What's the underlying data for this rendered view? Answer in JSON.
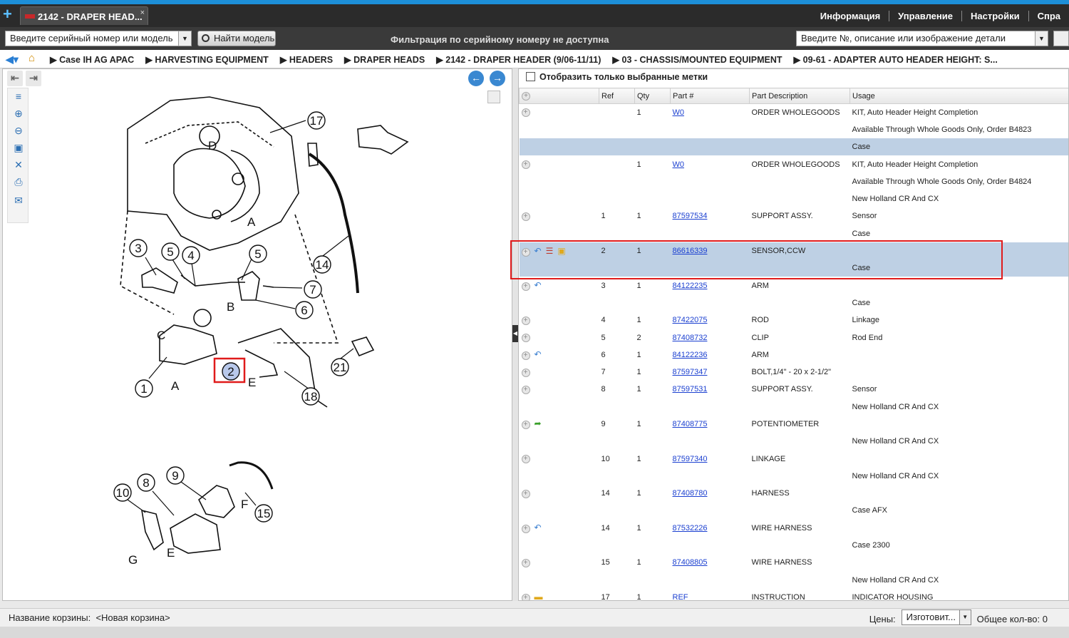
{
  "window": {
    "tab_title": "2142 - DRAPER HEAD...",
    "tab_close": "×",
    "new_tab": "+"
  },
  "topmenu": [
    "Информация",
    "Управление",
    "Настройки",
    "Спра"
  ],
  "toolbar": {
    "serial_input": "Введите серийный номер или модель",
    "find_model_button": "Найти модель",
    "filter_message": "Фильтрация по серийному номеру не доступна",
    "part_search_input": "Введите №, описание или изображение детали"
  },
  "breadcrumb": [
    "Case IH AG APAC",
    "HARVESTING EQUIPMENT",
    "HEADERS",
    "DRAPER HEADS",
    "2142 - DRAPER HEADER (9/06-11/11)",
    "03 - CHASSIS/MOUNTED EQUIPMENT",
    "09-61 - ADAPTER AUTO HEADER HEIGHT: S..."
  ],
  "diagram": {
    "callouts": [
      "17",
      "14",
      "3",
      "5",
      "4",
      "5",
      "7",
      "6",
      "1",
      "2",
      "18",
      "21",
      "10",
      "8",
      "9",
      "15"
    ],
    "letters": [
      "D",
      "A",
      "B",
      "C",
      "E",
      "A",
      "F",
      "G",
      "E"
    ]
  },
  "parts_panel": {
    "show_selected_label": "Отобразить только выбранные метки",
    "columns": [
      "Ref",
      "Qty",
      "Part #",
      "Part Description",
      "Usage"
    ],
    "rows": [
      {
        "ref": "",
        "qty": "1",
        "part": "W0",
        "desc": "ORDER WHOLEGOODS",
        "usage": "KIT, Auto Header Height Completion",
        "icons": []
      },
      {
        "ref": "",
        "qty": "",
        "part": "",
        "desc": "",
        "usage": "Available Through Whole Goods Only, Order B4823",
        "icons": []
      },
      {
        "ref": "",
        "qty": "",
        "part": "",
        "desc": "",
        "usage": "Case",
        "icons": [],
        "highlight": true
      },
      {
        "ref": "",
        "qty": "1",
        "part": "W0",
        "desc": "ORDER WHOLEGOODS",
        "usage": "KIT, Auto Header Height Completion",
        "icons": []
      },
      {
        "ref": "",
        "qty": "",
        "part": "",
        "desc": "",
        "usage": "Available Through Whole Goods Only, Order B4824",
        "icons": []
      },
      {
        "ref": "",
        "qty": "",
        "part": "",
        "desc": "",
        "usage": "New Holland CR And CX",
        "icons": []
      },
      {
        "ref": "1",
        "qty": "1",
        "part": "87597534",
        "desc": "SUPPORT ASSY.",
        "usage": "Sensor",
        "icons": []
      },
      {
        "ref": "",
        "qty": "",
        "part": "",
        "desc": "",
        "usage": "Case",
        "icons": []
      },
      {
        "ref": "2",
        "qty": "1",
        "part": "86616339",
        "desc": "SENSOR,CCW",
        "usage": "",
        "icons": [
          "replace",
          "list",
          "box"
        ],
        "highlight": true
      },
      {
        "ref": "",
        "qty": "",
        "part": "",
        "desc": "",
        "usage": "Case",
        "icons": [],
        "highlight": true
      },
      {
        "ref": "3",
        "qty": "1",
        "part": "84122235",
        "desc": "ARM",
        "usage": "",
        "icons": [
          "replace"
        ]
      },
      {
        "ref": "",
        "qty": "",
        "part": "",
        "desc": "",
        "usage": "Case",
        "icons": []
      },
      {
        "ref": "4",
        "qty": "1",
        "part": "87422075",
        "desc": "ROD",
        "usage": "Linkage",
        "icons": []
      },
      {
        "ref": "5",
        "qty": "2",
        "part": "87408732",
        "desc": "CLIP",
        "usage": "Rod End",
        "icons": []
      },
      {
        "ref": "6",
        "qty": "1",
        "part": "84122236",
        "desc": "ARM",
        "usage": "",
        "icons": [
          "replace"
        ]
      },
      {
        "ref": "7",
        "qty": "1",
        "part": "87597347",
        "desc": "BOLT,1/4\" - 20 x 2-1/2\"",
        "usage": "",
        "icons": []
      },
      {
        "ref": "8",
        "qty": "1",
        "part": "87597531",
        "desc": "SUPPORT ASSY.",
        "usage": "Sensor",
        "icons": []
      },
      {
        "ref": "",
        "qty": "",
        "part": "",
        "desc": "",
        "usage": "New Holland CR And CX",
        "icons": []
      },
      {
        "ref": "9",
        "qty": "1",
        "part": "87408775",
        "desc": "POTENTIOMETER",
        "usage": "",
        "icons": [
          "green-arrow"
        ]
      },
      {
        "ref": "",
        "qty": "",
        "part": "",
        "desc": "",
        "usage": "New Holland CR And CX",
        "icons": []
      },
      {
        "ref": "10",
        "qty": "1",
        "part": "87597340",
        "desc": "LINKAGE",
        "usage": "",
        "icons": []
      },
      {
        "ref": "",
        "qty": "",
        "part": "",
        "desc": "",
        "usage": "New Holland CR And CX",
        "icons": []
      },
      {
        "ref": "14",
        "qty": "1",
        "part": "87408780",
        "desc": "HARNESS",
        "usage": "",
        "icons": []
      },
      {
        "ref": "",
        "qty": "",
        "part": "",
        "desc": "",
        "usage": "Case AFX",
        "icons": []
      },
      {
        "ref": "14",
        "qty": "1",
        "part": "87532226",
        "desc": "WIRE HARNESS",
        "usage": "",
        "icons": [
          "replace"
        ]
      },
      {
        "ref": "",
        "qty": "",
        "part": "",
        "desc": "",
        "usage": "Case 2300",
        "icons": []
      },
      {
        "ref": "15",
        "qty": "1",
        "part": "87408805",
        "desc": "WIRE HARNESS",
        "usage": "",
        "icons": []
      },
      {
        "ref": "",
        "qty": "",
        "part": "",
        "desc": "",
        "usage": "New Holland CR And CX",
        "icons": []
      },
      {
        "ref": "17",
        "qty": "1",
        "part": "REF",
        "desc": "INSTRUCTION",
        "usage": "INDICATOR HOUSING",
        "icons": [
          "folder"
        ]
      }
    ]
  },
  "statusbar": {
    "cart_label": "Название корзины:",
    "cart_name": "<Новая корзина>",
    "prices_label": "Цены:",
    "prices_value": "Изготовит...",
    "total_label": "Общее кол-во: 0"
  },
  "colors": {
    "accent": "#1d8fd8",
    "highlight_row": "#bed0e4",
    "callout_box": "#e01b1b",
    "link": "#1a3fd0"
  }
}
